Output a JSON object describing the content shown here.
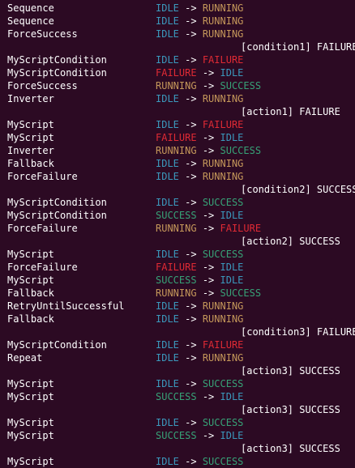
{
  "terminal": {
    "colors": {
      "background": "#2c0a23",
      "text": "#ffffff",
      "IDLE": "#3b98bc",
      "RUNNING": "#c4975a",
      "FAILURE": "#df2a34",
      "SUCCESS": "#37a277"
    },
    "lines": [
      {
        "node": "Sequence",
        "from": "IDLE",
        "to": "RUNNING"
      },
      {
        "node": "Sequence",
        "from": "IDLE",
        "to": "RUNNING"
      },
      {
        "node": "ForceSuccess",
        "from": "IDLE",
        "to": "RUNNING"
      },
      {
        "note": "[condition1] FAILURE"
      },
      {
        "node": "MyScriptCondition",
        "from": "IDLE",
        "to": "FAILURE"
      },
      {
        "node": "MyScriptCondition",
        "from": "FAILURE",
        "to": "IDLE"
      },
      {
        "node": "ForceSuccess",
        "from": "RUNNING",
        "to": "SUCCESS"
      },
      {
        "node": "Inverter",
        "from": "IDLE",
        "to": "RUNNING"
      },
      {
        "note": "[action1] FAILURE"
      },
      {
        "node": "MyScript",
        "from": "IDLE",
        "to": "FAILURE"
      },
      {
        "node": "MyScript",
        "from": "FAILURE",
        "to": "IDLE"
      },
      {
        "node": "Inverter",
        "from": "RUNNING",
        "to": "SUCCESS"
      },
      {
        "node": "Fallback",
        "from": "IDLE",
        "to": "RUNNING"
      },
      {
        "node": "ForceFailure",
        "from": "IDLE",
        "to": "RUNNING"
      },
      {
        "note": "[condition2] SUCCESS"
      },
      {
        "node": "MyScriptCondition",
        "from": "IDLE",
        "to": "SUCCESS"
      },
      {
        "node": "MyScriptCondition",
        "from": "SUCCESS",
        "to": "IDLE"
      },
      {
        "node": "ForceFailure",
        "from": "RUNNING",
        "to": "FAILURE"
      },
      {
        "note": "[action2] SUCCESS"
      },
      {
        "node": "MyScript",
        "from": "IDLE",
        "to": "SUCCESS"
      },
      {
        "node": "ForceFailure",
        "from": "FAILURE",
        "to": "IDLE"
      },
      {
        "node": "MyScript",
        "from": "SUCCESS",
        "to": "IDLE"
      },
      {
        "node": "Fallback",
        "from": "RUNNING",
        "to": "SUCCESS"
      },
      {
        "node": "RetryUntilSuccessful",
        "from": "IDLE",
        "to": "RUNNING"
      },
      {
        "node": "Fallback",
        "from": "IDLE",
        "to": "RUNNING"
      },
      {
        "note": "[condition3] FAILURE"
      },
      {
        "node": "MyScriptCondition",
        "from": "IDLE",
        "to": "FAILURE"
      },
      {
        "node": "Repeat",
        "from": "IDLE",
        "to": "RUNNING"
      },
      {
        "note": "[action3] SUCCESS"
      },
      {
        "node": "MyScript",
        "from": "IDLE",
        "to": "SUCCESS"
      },
      {
        "node": "MyScript",
        "from": "SUCCESS",
        "to": "IDLE"
      },
      {
        "note": "[action3] SUCCESS"
      },
      {
        "node": "MyScript",
        "from": "IDLE",
        "to": "SUCCESS"
      },
      {
        "node": "MyScript",
        "from": "SUCCESS",
        "to": "IDLE"
      },
      {
        "note": "[action3] SUCCESS"
      },
      {
        "node": "MyScript",
        "from": "IDLE",
        "to": "SUCCESS"
      }
    ],
    "arrow": "->"
  }
}
